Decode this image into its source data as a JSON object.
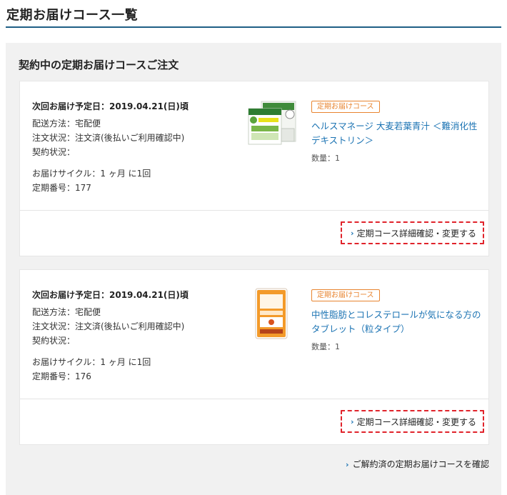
{
  "page_title": "定期お届けコース一覧",
  "section_title": "契約中の定期お届けコースご注文",
  "orders": [
    {
      "next_delivery": "次回お届け予定日：2019.04.21(日)頃",
      "shipping_method": "配送方法：宅配便",
      "order_status": "注文状況：注文済(後払いご利用確認中)",
      "contract_status": "契約状況：",
      "delivery_cycle": "お届けサイクル：1 ヶ月 に1回",
      "subscription_number": "定期番号：177",
      "badge": "定期お届けコース",
      "product_name": "ヘルスマネージ 大麦若葉青汁 ＜難消化性デキストリン＞",
      "quantity": "数量：1",
      "detail_link": "定期コース詳細確認・変更する"
    },
    {
      "next_delivery": "次回お届け予定日：2019.04.21(日)頃",
      "shipping_method": "配送方法：宅配便",
      "order_status": "注文状況：注文済(後払いご利用確認中)",
      "contract_status": "契約状況：",
      "delivery_cycle": "お届けサイクル：1 ヶ月 に1回",
      "subscription_number": "定期番号：176",
      "badge": "定期お届けコース",
      "product_name": "中性脂肪とコレステロールが気になる方のタブレット（粒タイプ）",
      "quantity": "数量：1",
      "detail_link": "定期コース詳細確認・変更する"
    }
  ],
  "cancelled_link": "ご解約済の定期お届けコースを確認",
  "icons": {
    "link_chevron": "chevron-right-icon"
  },
  "colors": {
    "header_rule": "#1f5f86",
    "panel_bg": "#f1f1f1",
    "link_blue": "#1b73b3",
    "badge_orange": "#e8842f",
    "highlight_red": "#e0232b"
  }
}
